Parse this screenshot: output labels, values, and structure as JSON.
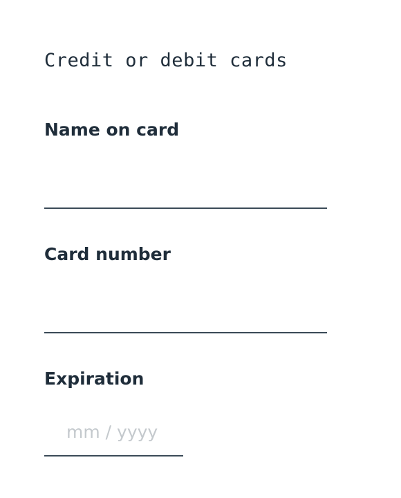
{
  "form": {
    "section_title": "Credit or debit cards",
    "name_on_card": {
      "label": "Name on card",
      "value": "",
      "placeholder": ""
    },
    "card_number": {
      "label": "Card number",
      "value": "",
      "placeholder": ""
    },
    "expiration": {
      "label": "Expiration",
      "value": "",
      "placeholder": "mm / yyyy"
    }
  }
}
